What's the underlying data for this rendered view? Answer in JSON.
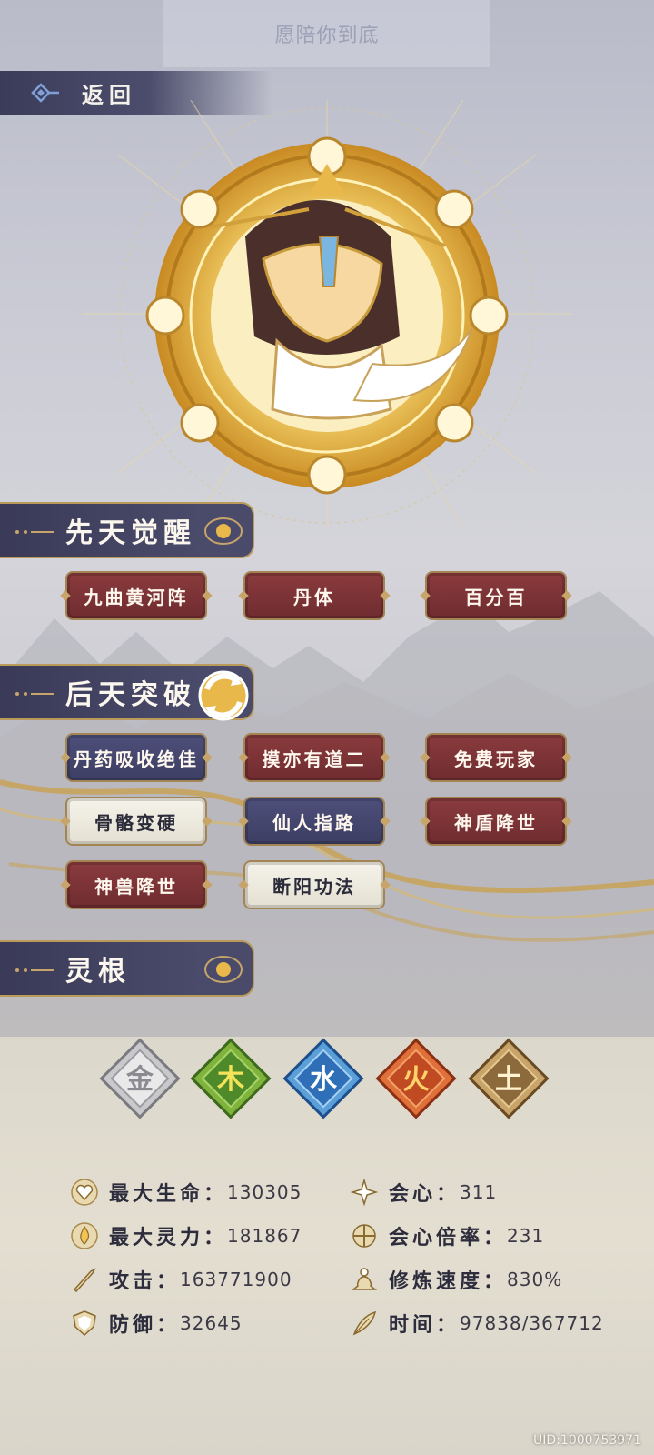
{
  "header": {
    "title": "愿陪你到底",
    "back_label": "返回"
  },
  "sections": {
    "innate": {
      "title": "先天觉醒"
    },
    "acquired": {
      "title": "后天突破"
    },
    "spirit_root": {
      "title": "灵根"
    }
  },
  "innate_tags": [
    {
      "label": "九曲黄河阵",
      "style": "red"
    },
    {
      "label": "丹体",
      "style": "red"
    },
    {
      "label": "百分百",
      "style": "red"
    }
  ],
  "acquired_tags": [
    {
      "label": "丹药吸收绝佳",
      "style": "blue"
    },
    {
      "label": "摸亦有道二",
      "style": "red"
    },
    {
      "label": "免费玩家",
      "style": "red"
    },
    {
      "label": "骨骼变硬",
      "style": "white"
    },
    {
      "label": "仙人指路",
      "style": "blue"
    },
    {
      "label": "神盾降世",
      "style": "red"
    },
    {
      "label": "神兽降世",
      "style": "red"
    },
    {
      "label": "断阳功法",
      "style": "white"
    }
  ],
  "elements": [
    {
      "char": "金",
      "color": "#c9c9cc",
      "inner": "#e9e9ea",
      "text": "#8a8a90"
    },
    {
      "char": "木",
      "color": "#7fb33c",
      "inner": "#4f8a2a",
      "text": "#f4e35a"
    },
    {
      "char": "水",
      "color": "#5a9fd8",
      "inner": "#2f6fb8",
      "text": "#ffffff"
    },
    {
      "char": "火",
      "color": "#e0703a",
      "inner": "#c04a22",
      "text": "#ffd36a"
    },
    {
      "char": "土",
      "color": "#c9a46a",
      "inner": "#8c6a3c",
      "text": "#fff2cf"
    }
  ],
  "stats": {
    "max_hp": {
      "label": "最大生命：",
      "value": "130305",
      "icon": "heart-icon"
    },
    "max_mana": {
      "label": "最大灵力：",
      "value": "181867",
      "icon": "flame-icon"
    },
    "attack": {
      "label": "攻击：",
      "value": "163771900",
      "icon": "sword-icon"
    },
    "defense": {
      "label": "防御：",
      "value": "32645",
      "icon": "shield-icon"
    },
    "crit": {
      "label": "会心：",
      "value": "311",
      "icon": "burst-icon"
    },
    "crit_mult": {
      "label": "会心倍率：",
      "value": "231",
      "icon": "crosshair-icon"
    },
    "cultivation_speed": {
      "label": "修炼速度：",
      "value": "830%",
      "icon": "meditation-icon"
    },
    "time": {
      "label": "时间：",
      "value": "97838/367712",
      "icon": "feather-icon"
    }
  },
  "uid": "UID:1000753971"
}
